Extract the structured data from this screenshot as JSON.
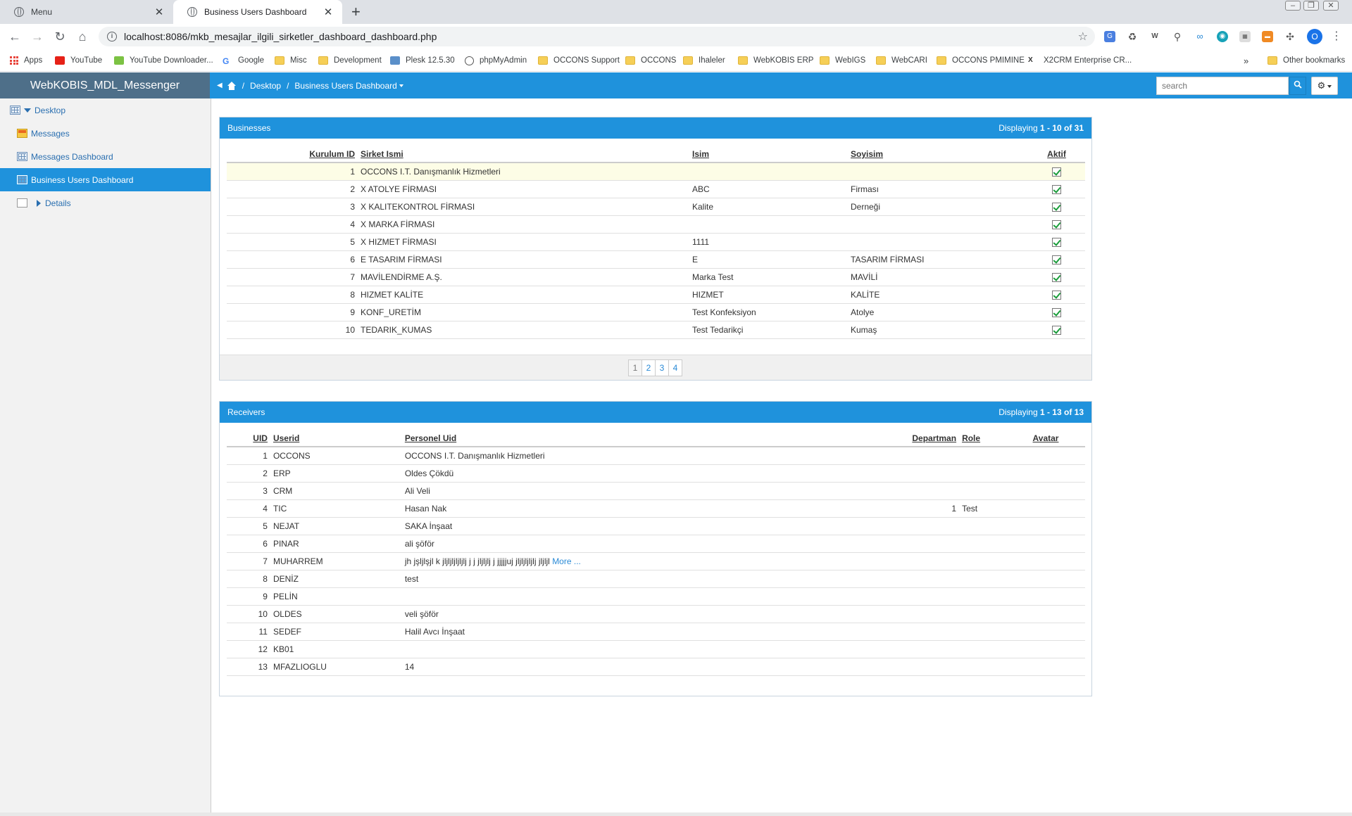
{
  "browser": {
    "tabs": [
      {
        "title": "Menu"
      },
      {
        "title": "Business Users Dashboard"
      }
    ],
    "url": "localhost:8086/mkb_mesajlar_ilgili_sirketler_dashboard_dashboard.php",
    "bookmarks": [
      "Apps",
      "YouTube",
      "YouTube Downloader...",
      "Google",
      "Misc",
      "Development",
      "Plesk 12.5.30",
      "phpMyAdmin",
      "OCCONS Support",
      "OCCONS",
      "Ihaleler",
      "WebKOBIS ERP",
      "WebIGS",
      "WebCARI",
      "OCCONS PMIMINE",
      "X2CRM Enterprise CR...",
      "Other bookmarks"
    ],
    "bookmarks_overflow": "»",
    "profile_initial": "O"
  },
  "app": {
    "brand": "WebKOBIS_MDL_Messenger",
    "breadcrumb": {
      "desktop": "Desktop",
      "sep": "/",
      "current": "Business Users Dashboard"
    },
    "search_placeholder": "search",
    "accent_color": "#1f92dc"
  },
  "sidebar": {
    "items": [
      {
        "label": "Desktop",
        "icon": "grid-icon"
      },
      {
        "label": "Messages",
        "icon": "mail-icon"
      },
      {
        "label": "Messages Dashboard",
        "icon": "grid-icon"
      },
      {
        "label": "Business Users Dashboard",
        "icon": "grid-icon",
        "active": true
      },
      {
        "label": "Details",
        "icon": "page-icon"
      }
    ]
  },
  "businesses": {
    "title": "Businesses",
    "display_prefix": "Displaying",
    "display_range": "1 - 10 of 31",
    "columns": [
      "Kurulum ID",
      "Sirket Ismi",
      "Isim",
      "Soyisim",
      "Aktif"
    ],
    "rows": [
      {
        "id": "1",
        "company": "OCCONS I.T. Danışmanlık Hizmetleri",
        "name": "",
        "surname": "",
        "active": true
      },
      {
        "id": "2",
        "company": "X ATOLYE FİRMASI",
        "name": "ABC",
        "surname": "Firması",
        "active": true
      },
      {
        "id": "3",
        "company": "X KALITEKONTROL FİRMASI",
        "name": "Kalite",
        "surname": "Derneği",
        "active": true
      },
      {
        "id": "4",
        "company": "X MARKA FİRMASI",
        "name": "",
        "surname": "",
        "active": true
      },
      {
        "id": "5",
        "company": "X HIZMET FİRMASI",
        "name": "1111",
        "surname": "",
        "active": true
      },
      {
        "id": "6",
        "company": "E TASARIM FİRMASI",
        "name": "E",
        "surname": "TASARIM FİRMASI",
        "active": true
      },
      {
        "id": "7",
        "company": "MAVİLENDİRME A.Ş.",
        "name": "Marka Test",
        "surname": "MAVİLİ",
        "active": true
      },
      {
        "id": "8",
        "company": "HIZMET KALİTE",
        "name": "HIZMET",
        "surname": "KALİTE",
        "active": true
      },
      {
        "id": "9",
        "company": "KONF_URETİM",
        "name": "Test Konfeksiyon",
        "surname": "Atolye",
        "active": true
      },
      {
        "id": "10",
        "company": "TEDARIK_KUMAS",
        "name": "Test Tedarikçi",
        "surname": "Kumaş",
        "active": true
      }
    ],
    "pages": [
      "1",
      "2",
      "3",
      "4"
    ],
    "current_page": "1"
  },
  "receivers": {
    "title": "Receivers",
    "display_prefix": "Displaying",
    "display_range": "1 - 13 of 13",
    "columns": [
      "UID",
      "Userid",
      "Personel Uid",
      "Departman",
      "Role",
      "Avatar"
    ],
    "more_label": "More ...",
    "rows": [
      {
        "uid": "1",
        "userid": "OCCONS",
        "personel": "OCCONS I.T. Danışmanlık Hizmetleri",
        "dept": "",
        "role": "",
        "more": false
      },
      {
        "uid": "2",
        "userid": "ERP",
        "personel": "Oldes Çökdü",
        "dept": "",
        "role": "",
        "more": false
      },
      {
        "uid": "3",
        "userid": "CRM",
        "personel": "Ali Veli",
        "dept": "",
        "role": "",
        "more": false
      },
      {
        "uid": "4",
        "userid": "TIC",
        "personel": "Hasan Nak",
        "dept": "1",
        "role": "Test",
        "more": false
      },
      {
        "uid": "5",
        "userid": "NEJAT",
        "personel": "SAKA İnşaat",
        "dept": "",
        "role": "",
        "more": false
      },
      {
        "uid": "6",
        "userid": "PINAR",
        "personel": "ali şöför",
        "dept": "",
        "role": "",
        "more": false
      },
      {
        "uid": "7",
        "userid": "MUHARREM",
        "personel": "jh jşljlşjl k jljljljljljlj j j jljljlj j jjjjjuj jljljljljlj jljljl",
        "dept": "",
        "role": "",
        "more": true
      },
      {
        "uid": "8",
        "userid": "DENİZ",
        "personel": "test",
        "dept": "",
        "role": "",
        "more": false
      },
      {
        "uid": "9",
        "userid": "PELİN",
        "personel": "",
        "dept": "",
        "role": "",
        "more": false
      },
      {
        "uid": "10",
        "userid": "OLDES",
        "personel": "veli şöför",
        "dept": "",
        "role": "",
        "more": false
      },
      {
        "uid": "11",
        "userid": "SEDEF",
        "personel": "Halil Avcı İnşaat",
        "dept": "",
        "role": "",
        "more": false
      },
      {
        "uid": "12",
        "userid": "KB01",
        "personel": "",
        "dept": "",
        "role": "",
        "more": false
      },
      {
        "uid": "13",
        "userid": "MFAZLIOGLU",
        "personel": "14",
        "dept": "",
        "role": "",
        "more": false
      }
    ]
  }
}
